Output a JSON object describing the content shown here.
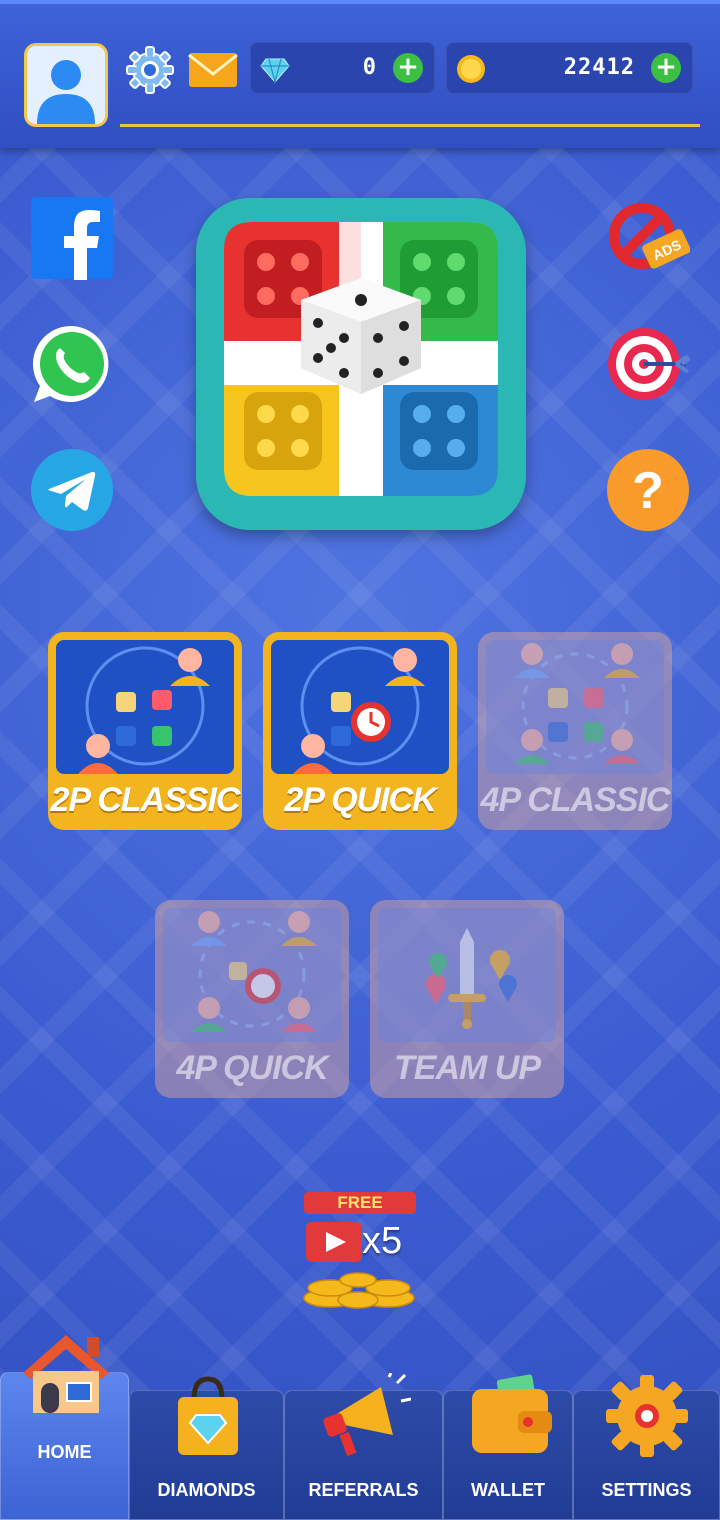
{
  "header": {
    "diamonds": "0",
    "coins": "22412",
    "plus": "+"
  },
  "side_left": [
    "facebook-icon",
    "whatsapp-icon",
    "telegram-icon"
  ],
  "side_right": [
    "no-ads-icon",
    "target-icon",
    "help-icon"
  ],
  "modes": [
    {
      "label": "2P CLASSIC",
      "enabled": true
    },
    {
      "label": "2P QUICK",
      "enabled": true
    },
    {
      "label": "4P CLASSIC",
      "enabled": false
    },
    {
      "label": "4P QUICK",
      "enabled": false
    },
    {
      "label": "TEAM UP",
      "enabled": false
    }
  ],
  "reward": {
    "ribbon": "FREE",
    "multiplier": "x5"
  },
  "help_glyph": "?",
  "no_ads_text": "ADS",
  "nav": [
    {
      "label": "HOME",
      "active": true
    },
    {
      "label": "DIAMONDS",
      "active": false
    },
    {
      "label": "REFERRALS",
      "active": false
    },
    {
      "label": "WALLET",
      "active": false
    },
    {
      "label": "SETTINGS",
      "active": false
    }
  ],
  "colors": {
    "accent_gold": "#f3b51f",
    "plus_green": "#3cbf43",
    "nav_bg": "#213c95"
  }
}
